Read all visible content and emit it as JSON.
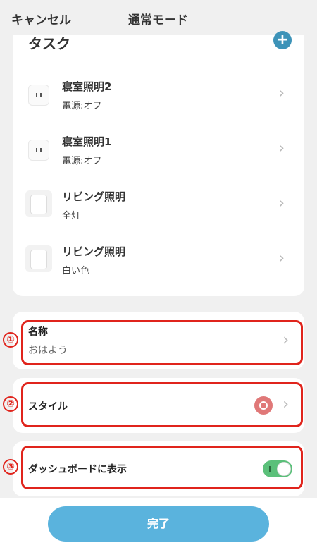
{
  "header": {
    "cancel_label": "キャンセル",
    "title": "通常モード"
  },
  "task": {
    "title": "タスク",
    "add_icon": "plus-icon",
    "items": [
      {
        "name": "寝室照明2",
        "status": "電源:オフ",
        "icon": "smart-plug-icon"
      },
      {
        "name": "寝室照明1",
        "status": "電源:オフ",
        "icon": "smart-plug-icon"
      },
      {
        "name": "リビング照明",
        "status": "全灯",
        "icon": "light-switch-icon"
      },
      {
        "name": "リビング照明",
        "status": "白い色",
        "icon": "light-switch-icon"
      }
    ]
  },
  "name_field": {
    "label": "名称",
    "value": "おはよう",
    "marker": "①"
  },
  "style_field": {
    "label": "スタイル",
    "marker": "②",
    "icon": "sun-style-icon",
    "icon_color": "#e07878"
  },
  "dashboard_field": {
    "label": "ダッシュボードに表示",
    "marker": "③",
    "enabled": true,
    "toggle_color": "#5bc07a"
  },
  "footer": {
    "done_label": "完了",
    "button_color": "#5ab3dd"
  },
  "annotation_color": "#e0241c"
}
